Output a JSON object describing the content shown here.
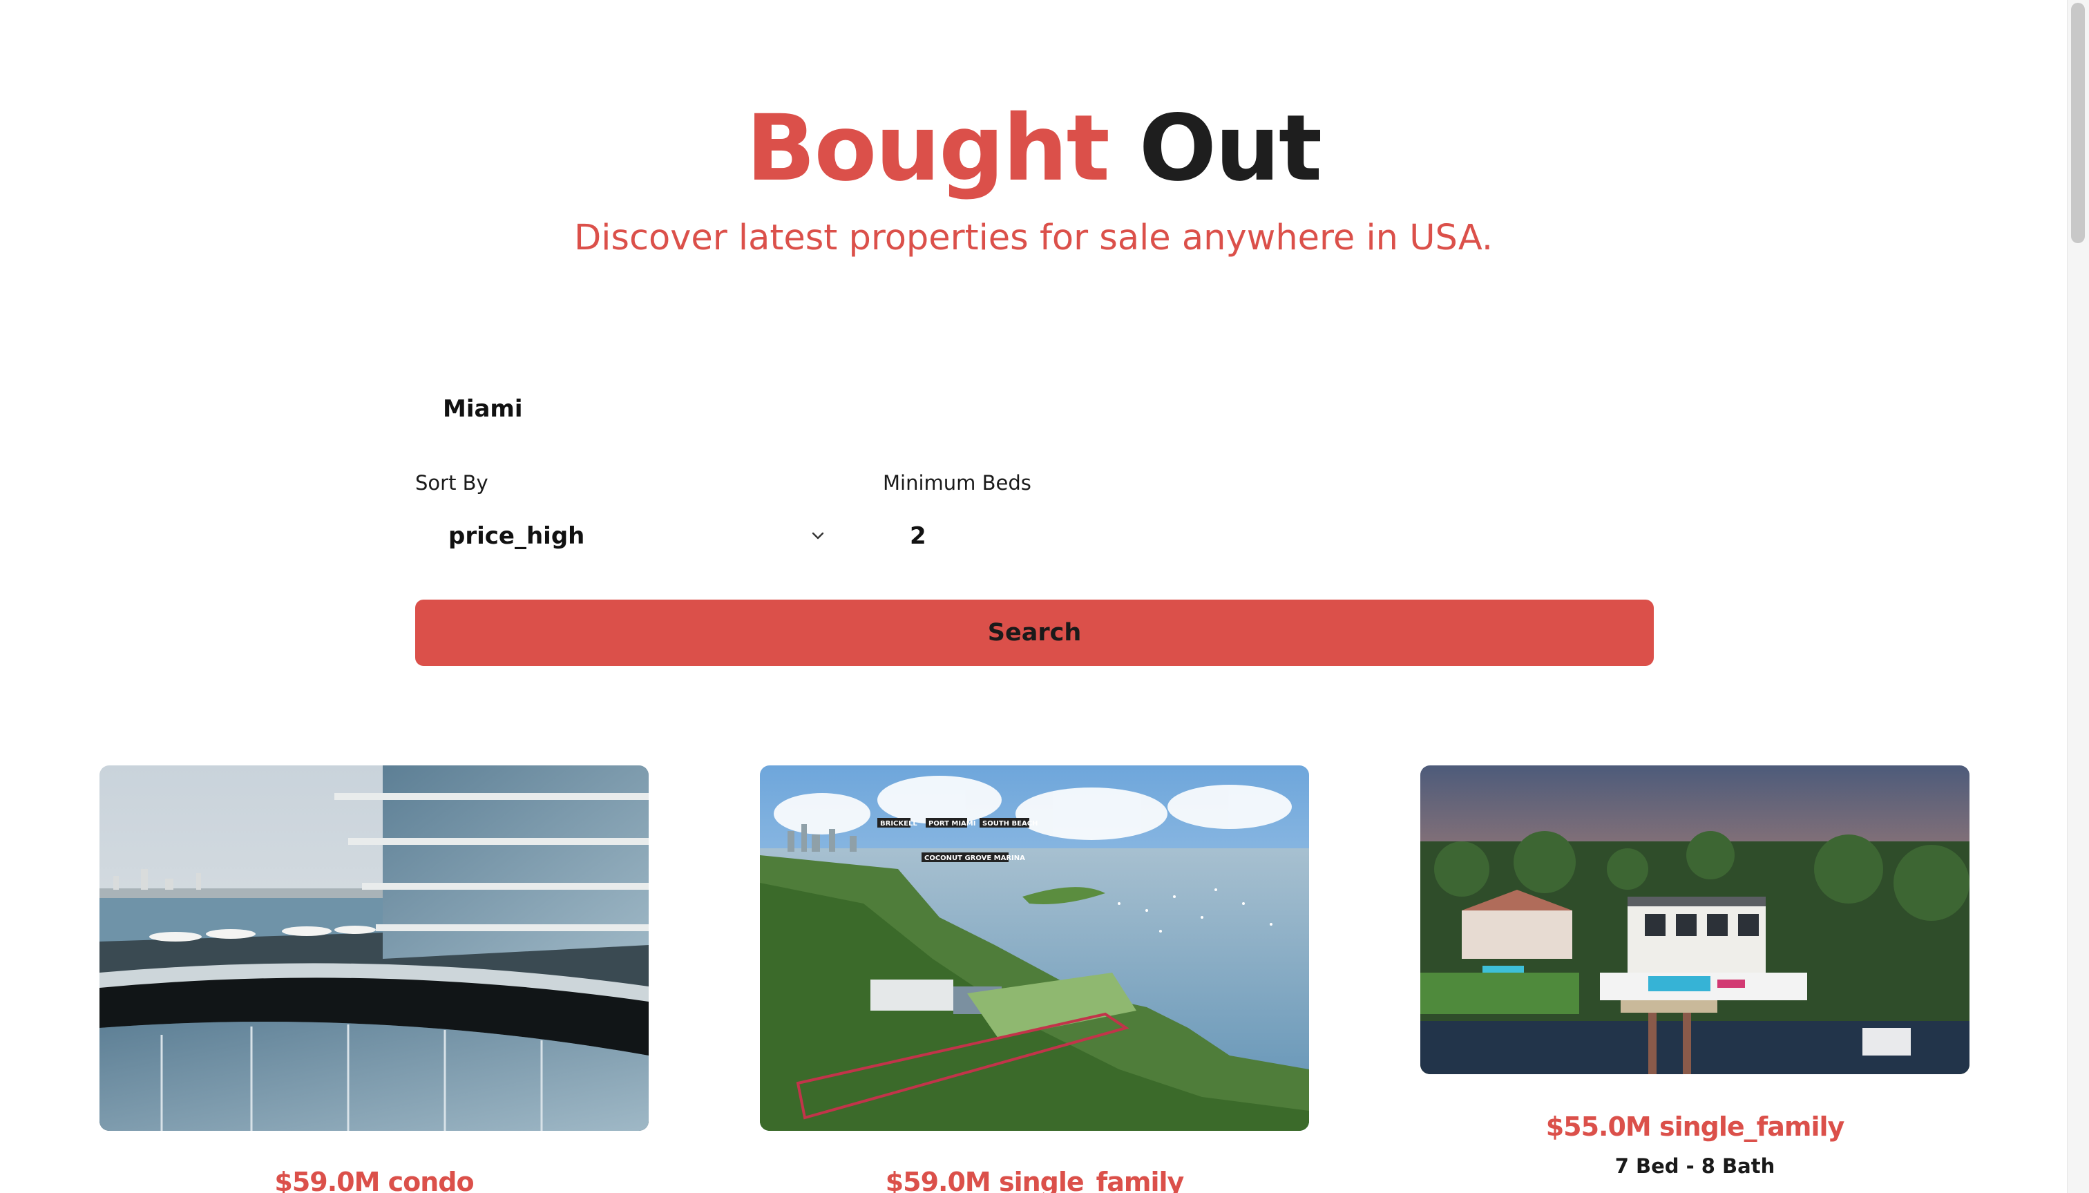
{
  "header": {
    "title_accent": "Bought",
    "title_rest": "Out",
    "subtitle": "Discover latest properties for sale anywhere in USA."
  },
  "search": {
    "location_value": "Miami",
    "sort_label": "Sort By",
    "sort_value": "price_high",
    "beds_label": "Minimum Beds",
    "beds_value": "2",
    "button_label": "Search"
  },
  "listings": [
    {
      "price_type": "$59.0M condo",
      "meta": ""
    },
    {
      "price_type": "$59.0M single_family",
      "meta": ""
    },
    {
      "price_type": "$55.0M single_family",
      "meta": "7 Bed - 8 Bath"
    }
  ],
  "photo_labels": [
    "BRICKELL",
    "PORT MIAMI",
    "SOUTH BEACH",
    "COCONUT GROVE MARINA"
  ],
  "colors": {
    "accent": "#db504a",
    "dark": "#1e1e1e"
  }
}
